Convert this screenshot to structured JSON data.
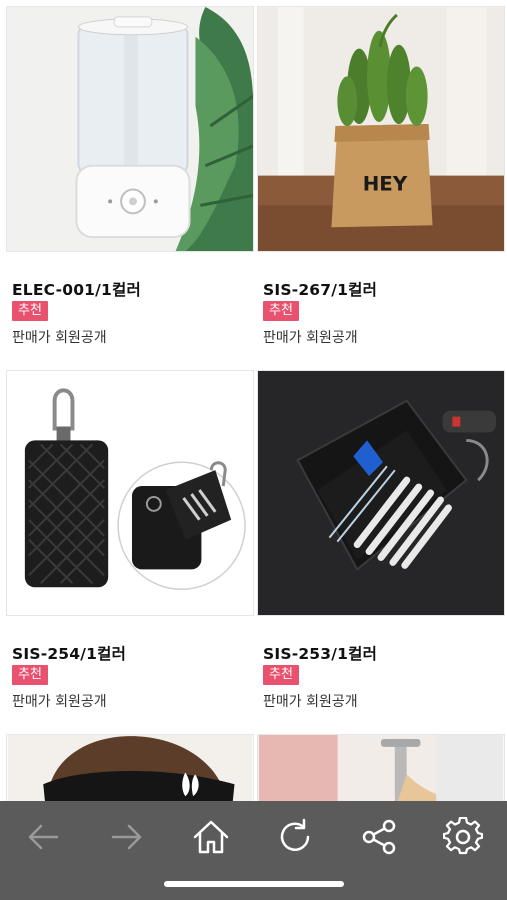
{
  "products": [
    {
      "code": "ELEC-001/1컬러",
      "badge": "추천",
      "price": "판매가 회원공개",
      "image": "humidifier-photo"
    },
    {
      "code": "SIS-267/1컬러",
      "badge": "추천",
      "price": "판매가 회원공개",
      "image": "cactus-pot-photo",
      "pot_text": "HEY"
    },
    {
      "code": "SIS-254/1컬러",
      "badge": "추천",
      "price": "판매가 회원공개",
      "image": "key-wallet-photo"
    },
    {
      "code": "SIS-253/1컬러",
      "badge": "추천",
      "price": "판매가 회원공개",
      "image": "key-wallet-open-photo"
    },
    {
      "image": "headband-photo"
    },
    {
      "image": "faucet-photo"
    }
  ],
  "nav": {
    "back_icon": "arrow-left-icon",
    "forward_icon": "arrow-right-icon",
    "home_icon": "home-icon",
    "reload_icon": "reload-icon",
    "share_icon": "share-icon",
    "settings_icon": "gear-icon"
  },
  "colors": {
    "badge": "#e8526e",
    "bottom_bar": "#5b5b5b",
    "nav_disabled": "#9a9a9a",
    "nav_active": "#ffffff"
  }
}
